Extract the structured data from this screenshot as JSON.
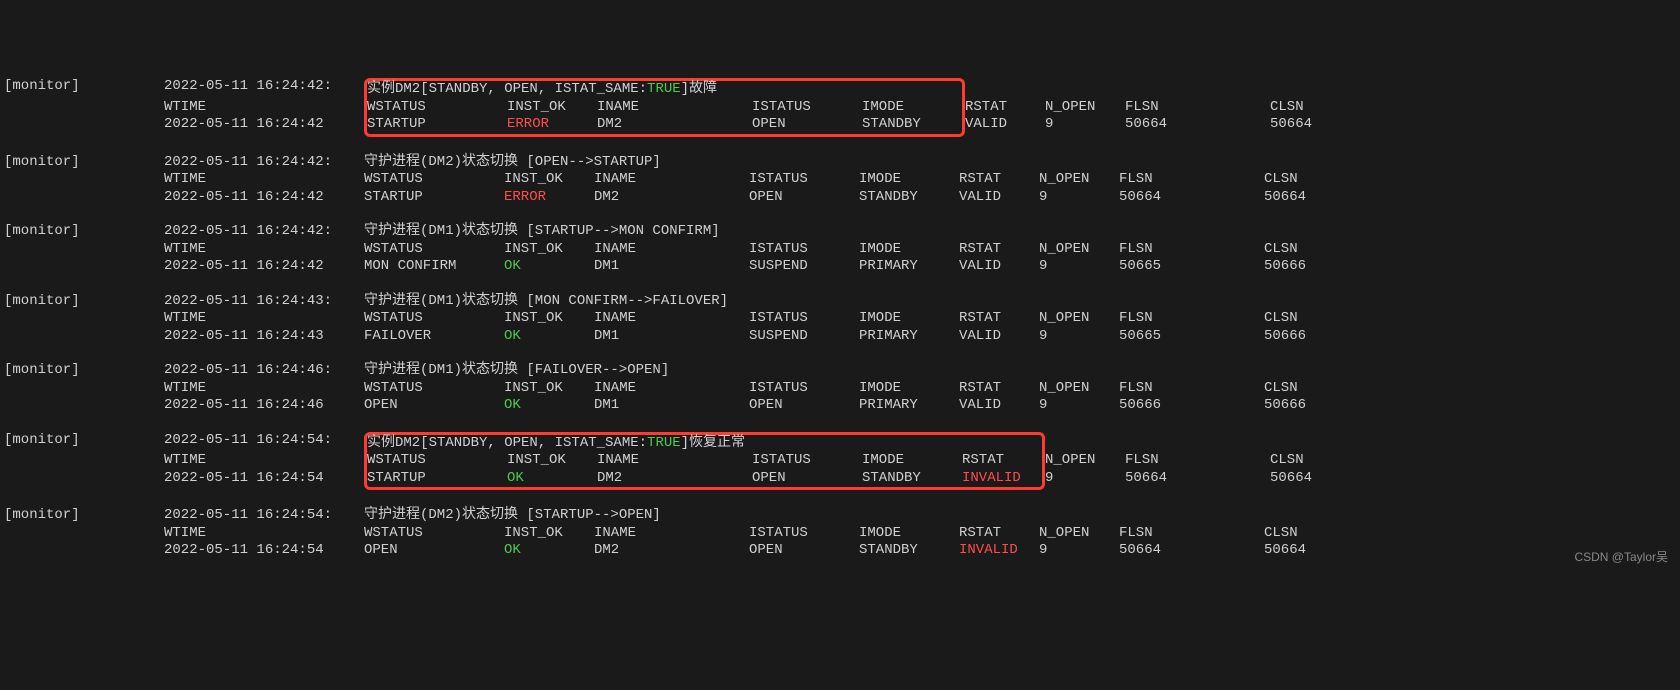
{
  "tag": "[monitor]",
  "headers": {
    "wtime": "WTIME",
    "wstatus": "WSTATUS",
    "inst_ok": "INST_OK",
    "iname": "INAME",
    "istatus": "ISTATUS",
    "imode": "IMODE",
    "rstat": "RSTAT",
    "n_open": "N_OPEN",
    "flsn": "FLSN",
    "clsn": "CLSN"
  },
  "blocks": [
    {
      "ts_line": "2022-05-11 16:24:42:",
      "msg_pre": "实例DM2[STANDBY, OPEN, ISTAT_SAME:",
      "msg_hl": "TRUE",
      "msg_post": "]故障",
      "boxed": true,
      "box_includes_rstat": false,
      "data_ts": "2022-05-11 16:24:42",
      "wstatus": "STARTUP",
      "inst_ok": "ERROR",
      "inst_ok_color": "red",
      "iname": "DM2",
      "istatus": "OPEN",
      "imode": "STANDBY",
      "rstat": "VALID",
      "rstat_color": "",
      "n_open": "9",
      "flsn": "50664",
      "clsn": "50664"
    },
    {
      "ts_line": "2022-05-11 16:24:42:",
      "msg_pre": "守护进程(DM2)状态切换 [OPEN-->STARTUP]",
      "msg_hl": "",
      "msg_post": "",
      "boxed": false,
      "data_ts": "2022-05-11 16:24:42",
      "wstatus": "STARTUP",
      "inst_ok": "ERROR",
      "inst_ok_color": "red",
      "iname": "DM2",
      "istatus": "OPEN",
      "imode": "STANDBY",
      "rstat": "VALID",
      "rstat_color": "",
      "n_open": "9",
      "flsn": "50664",
      "clsn": "50664"
    },
    {
      "ts_line": "2022-05-11 16:24:42:",
      "msg_pre": "守护进程(DM1)状态切换 [STARTUP-->MON CONFIRM]",
      "msg_hl": "",
      "msg_post": "",
      "boxed": false,
      "data_ts": "2022-05-11 16:24:42",
      "wstatus": "MON CONFIRM",
      "inst_ok": "OK",
      "inst_ok_color": "green",
      "iname": "DM1",
      "istatus": "SUSPEND",
      "imode": "PRIMARY",
      "rstat": "VALID",
      "rstat_color": "",
      "n_open": "9",
      "flsn": "50665",
      "clsn": "50666"
    },
    {
      "ts_line": "2022-05-11 16:24:43:",
      "msg_pre": "守护进程(DM1)状态切换 [MON CONFIRM-->FAILOVER]",
      "msg_hl": "",
      "msg_post": "",
      "boxed": false,
      "data_ts": "2022-05-11 16:24:43",
      "wstatus": "FAILOVER",
      "inst_ok": "OK",
      "inst_ok_color": "green",
      "iname": "DM1",
      "istatus": "SUSPEND",
      "imode": "PRIMARY",
      "rstat": "VALID",
      "rstat_color": "",
      "n_open": "9",
      "flsn": "50665",
      "clsn": "50666"
    },
    {
      "ts_line": "2022-05-11 16:24:46:",
      "msg_pre": "守护进程(DM1)状态切换 [FAILOVER-->OPEN]",
      "msg_hl": "",
      "msg_post": "",
      "boxed": false,
      "data_ts": "2022-05-11 16:24:46",
      "wstatus": "OPEN",
      "inst_ok": "OK",
      "inst_ok_color": "green",
      "iname": "DM1",
      "istatus": "OPEN",
      "imode": "PRIMARY",
      "rstat": "VALID",
      "rstat_color": "",
      "n_open": "9",
      "flsn": "50666",
      "clsn": "50666"
    },
    {
      "ts_line": "2022-05-11 16:24:54:",
      "msg_pre": "实例DM2[STANDBY, OPEN, ISTAT_SAME:",
      "msg_hl": "TRUE",
      "msg_post": "]恢复正常",
      "boxed": true,
      "box_includes_rstat": true,
      "data_ts": "2022-05-11 16:24:54",
      "wstatus": "STARTUP",
      "inst_ok": "OK",
      "inst_ok_color": "green",
      "iname": "DM2",
      "istatus": "OPEN",
      "imode": "STANDBY",
      "rstat": "INVALID",
      "rstat_color": "red",
      "n_open": "9",
      "flsn": "50664",
      "clsn": "50664"
    },
    {
      "ts_line": "2022-05-11 16:24:54:",
      "msg_pre": "守护进程(DM2)状态切换 [STARTUP-->OPEN]",
      "msg_hl": "",
      "msg_post": "",
      "boxed": false,
      "data_ts": "2022-05-11 16:24:54",
      "wstatus": "OPEN",
      "inst_ok": "OK",
      "inst_ok_color": "green",
      "iname": "DM2",
      "istatus": "OPEN",
      "imode": "STANDBY",
      "rstat": "INVALID",
      "rstat_color": "red",
      "n_open": "9",
      "flsn": "50664",
      "clsn": "50664"
    }
  ],
  "watermark": "CSDN @Taylor吴"
}
